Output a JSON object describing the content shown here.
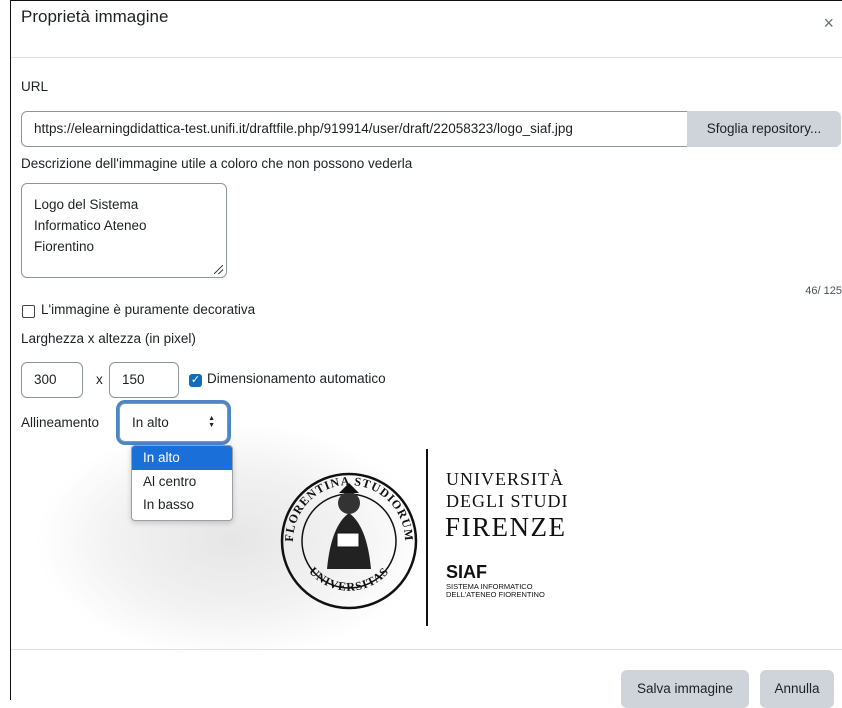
{
  "dialog": {
    "title": "Proprietà immagine",
    "close_glyph": "×"
  },
  "url": {
    "label": "URL",
    "value": "https://elearningdidattica-test.unifi.it/draftfile.php/919914/user/draft/22058323/logo_siaf.jpg",
    "browse_label": "Sfoglia repository..."
  },
  "description": {
    "label": "Descrizione dell'immagine utile a coloro che non possono vederla",
    "value_lines": [
      "Logo del Sistema",
      "Informatico Ateneo",
      "Fiorentino"
    ],
    "counter": "46/ 125"
  },
  "decorative": {
    "label": "L'immagine è puramente decorativa",
    "checked": false
  },
  "size": {
    "label": "Larghezza x altezza (in pixel)",
    "width": "300",
    "separator": "x",
    "height": "150",
    "auto_label": "Dimensionamento automatico",
    "auto_checked": true
  },
  "alignment": {
    "label": "Allineamento",
    "selected": "In alto",
    "options": [
      "In alto",
      "Al centro",
      "In basso"
    ]
  },
  "preview_logo": {
    "seal_top": "FLORENTINA STUDIORUM",
    "seal_bottom": "UNIVERSITAS",
    "line1": "UNIVERSITÀ",
    "line2": "DEGLI STUDI",
    "line3": "FIRENZE",
    "siaf": "SIAF",
    "siaf_sub1": "SISTEMA INFORMATICO",
    "siaf_sub2": "DELL'ATENEO FIORENTINO"
  },
  "footer": {
    "save_label": "Salva immagine",
    "cancel_label": "Annulla"
  },
  "colors": {
    "primary": "#0f6cbf",
    "focus_ring": "#4a87c7",
    "option_highlight": "#1a6fd9",
    "secondary_button": "#ced4da"
  }
}
